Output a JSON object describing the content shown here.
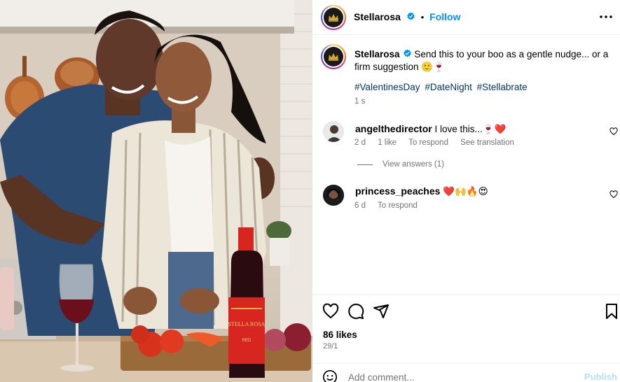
{
  "post": {
    "author": "Stellarosa",
    "follow_label": "Follow",
    "separator": "•",
    "caption_text": "Send this to your boo as a gentle nudge... or a firm suggestion 🙂🍷",
    "hashtags": [
      "#ValentinesDay",
      "#DateNight",
      "#Stellabrate"
    ],
    "caption_time": "1 s"
  },
  "comments": [
    {
      "user": "angelthedirector",
      "text": "I love this...🍷❤️",
      "time": "2 d",
      "likes": "1 like",
      "reply_label": "To respond",
      "translate_label": "See translation",
      "view_answers": "View answers (1)"
    },
    {
      "user": "princess_peaches",
      "text": "❤️🙌🔥😍",
      "time": "6 d",
      "reply_label": "To respond"
    }
  ],
  "stats": {
    "likes": "86 likes",
    "date": "29/1"
  },
  "composer": {
    "placeholder": "Add comment...",
    "publish_label": "Publish"
  },
  "colors": {
    "accent": "#0095f6",
    "secondary_text": "#737373",
    "hashtag": "#00376b",
    "wine_label": "#d7261f"
  },
  "photo": {
    "bottle_brand": "STELLA ROSA",
    "bottle_variety": "RED"
  },
  "icons": [
    "verified-badge-icon",
    "more-icon",
    "heart-icon",
    "comment-icon",
    "share-icon",
    "bookmark-icon",
    "emoji-icon"
  ]
}
